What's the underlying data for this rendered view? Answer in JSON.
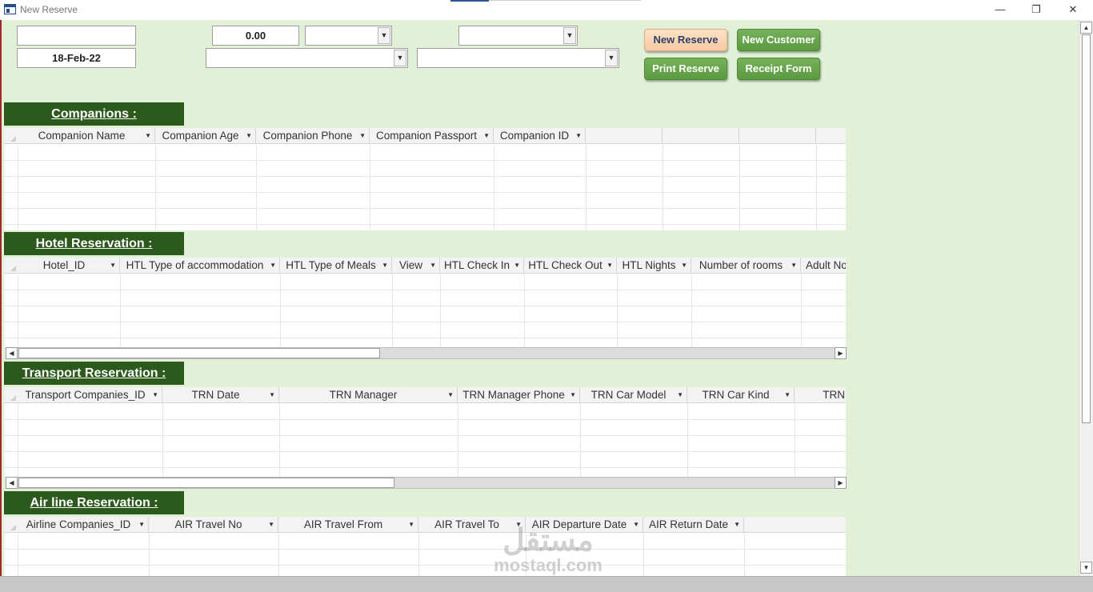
{
  "window": {
    "title": "New Reserve",
    "minimize_glyph": "—",
    "maximize_glyph": "❐",
    "close_glyph": "✕",
    "icon": "form-icon"
  },
  "header_fields": {
    "field_top_left": "",
    "date_value": "18-Feb-22",
    "amount_value": "0.00",
    "combo_small": "",
    "combo_top_right": "",
    "combo_wide_left": "",
    "combo_wide_right": ""
  },
  "buttons": {
    "new_reserve": "New Reserve",
    "new_customer": "New Customer",
    "print_reserve": "Print Reserve",
    "receipt_form": "Receipt Form"
  },
  "sections": {
    "companions": {
      "title": "Companions :",
      "columns": [
        "Companion Name",
        "Companion Age",
        "Companion Phone",
        "Companion Passport",
        "Companion ID"
      ]
    },
    "hotel": {
      "title": "Hotel Reservation :",
      "columns": [
        "Hotel_ID",
        "HTL Type of accommodation",
        "HTL Type of Meals",
        "View",
        "HTL Check In",
        "HTL Check Out",
        "HTL Nights",
        "Number of rooms",
        "Adult No"
      ]
    },
    "transport": {
      "title": "Transport Reservation :",
      "columns": [
        "Transport Companies_ID",
        "TRN Date",
        "TRN Manager",
        "TRN Manager Phone",
        "TRN Car Model",
        "TRN Car Kind",
        "TRN"
      ]
    },
    "airline": {
      "title": "Air line Reservation :",
      "columns": [
        "Airline Companies_ID",
        "AIR Travel No",
        "AIR Travel From",
        "AIR Travel To",
        "AIR Departure Date",
        "AIR Return Date"
      ]
    }
  },
  "watermark": {
    "arabic": "مستقل",
    "latin": "mostaql.com"
  },
  "colors": {
    "form_background": "#e1f0d7",
    "section_header": "#2c5a1c",
    "button_green": "#5a9a3f",
    "button_peach": "#f7c9a3"
  }
}
